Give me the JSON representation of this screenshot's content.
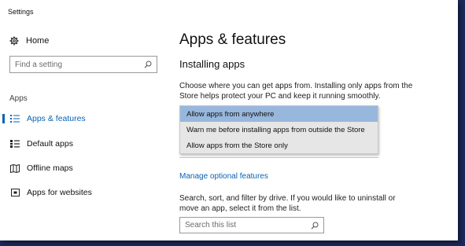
{
  "window": {
    "title": "Settings"
  },
  "sidebar": {
    "home_label": "Home",
    "search_placeholder": "Find a setting",
    "section_label": "Apps",
    "items": [
      {
        "label": "Apps & features",
        "icon": "list-icon",
        "active": true
      },
      {
        "label": "Default apps",
        "icon": "default-apps-icon",
        "active": false
      },
      {
        "label": "Offline maps",
        "icon": "map-icon",
        "active": false
      },
      {
        "label": "Apps for websites",
        "icon": "web-app-icon",
        "active": false
      }
    ]
  },
  "main": {
    "title": "Apps & features",
    "section_title": "Installing apps",
    "description": "Choose where you can get apps from. Installing only apps from the Store helps protect your PC and keep it running smoothly.",
    "dropdown": {
      "options": [
        "Allow apps from anywhere",
        "Warn me before installing apps from outside the Store",
        "Allow apps from the Store only"
      ],
      "selected_index": 0
    },
    "manage_link": "Manage optional features",
    "filter_description": "Search, sort, and filter by drive. If you would like to uninstall or move an app, select it from the list.",
    "list_search_placeholder": "Search this list"
  },
  "colors": {
    "accent": "#0a62b4",
    "selected_option": "#98b7dd",
    "dropdown_bg": "#e6e6e6",
    "backdrop": "#1b2a5c"
  }
}
